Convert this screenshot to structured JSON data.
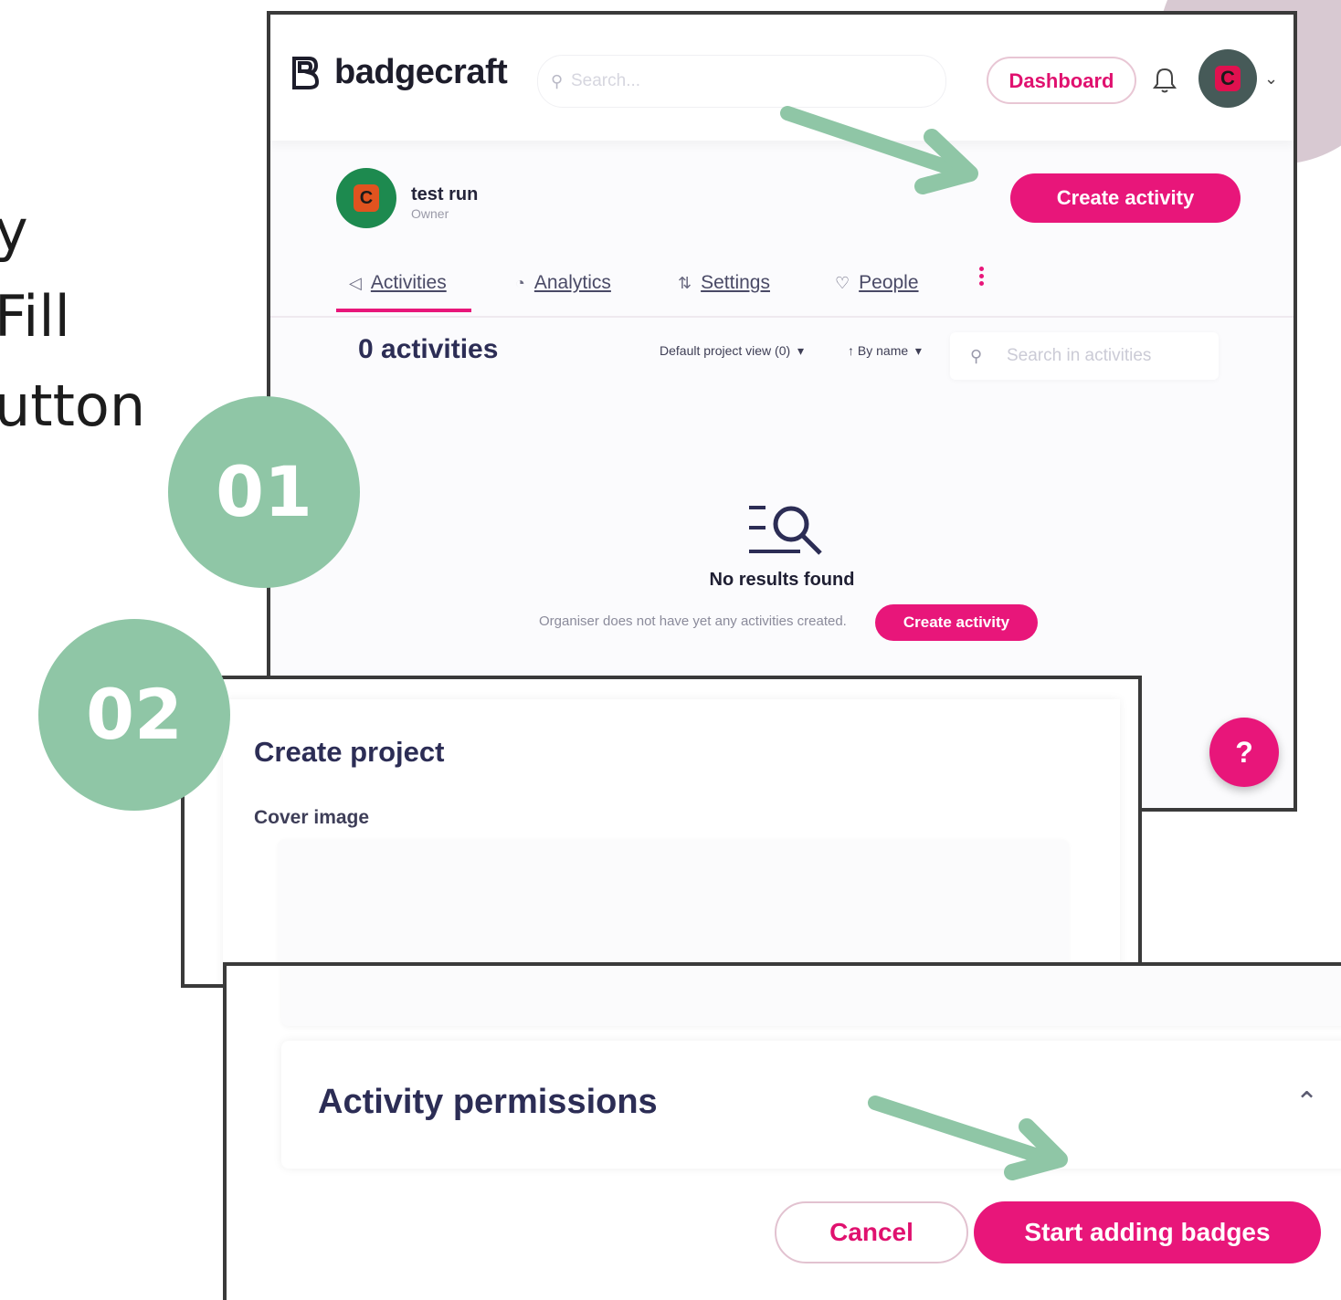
{
  "side_text": [
    "y",
    "Fill",
    "utton"
  ],
  "app": {
    "logo": "badgecraft",
    "search_placeholder": "Search...",
    "dashboard_label": "Dashboard"
  },
  "project": {
    "avatar_letter": "C",
    "name": "test run",
    "role": "Owner",
    "create_label": "Create activity"
  },
  "tabs": [
    {
      "label": "Activities"
    },
    {
      "label": "Analytics"
    },
    {
      "label": "Settings"
    },
    {
      "label": "People"
    }
  ],
  "list": {
    "count_label": "0 activities",
    "view_label": "Default project view (0)",
    "sort_label": "By name",
    "search_placeholder": "Search in activities"
  },
  "empty": {
    "title": "No results found",
    "text": "Organiser does not have yet any activities created.",
    "button": "Create activity"
  },
  "help_label": "?",
  "modal": {
    "title": "Create project",
    "cover_label": "Cover image",
    "permissions_title": "Activity permissions",
    "cancel_label": "Cancel",
    "submit_label": "Start adding badges"
  },
  "steps": [
    "01",
    "02"
  ],
  "colors": {
    "brand_pink": "#e8167a",
    "step_green": "#8fc6a6",
    "text_navy": "#2c2d55"
  }
}
